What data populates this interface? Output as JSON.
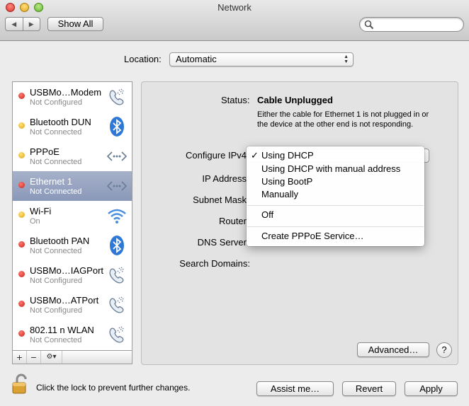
{
  "window": {
    "title": "Network"
  },
  "toolbar": {
    "back_label": "◀",
    "forward_label": "▶",
    "show_all_label": "Show All",
    "search_placeholder": ""
  },
  "location": {
    "label": "Location:",
    "value": "Automatic"
  },
  "services": [
    {
      "name": "USBMo…Modem",
      "status": "Not Configured",
      "dot": "red",
      "icon": "phone-icon"
    },
    {
      "name": "Bluetooth DUN",
      "status": "Not Connected",
      "dot": "yellow",
      "icon": "bluetooth-icon"
    },
    {
      "name": "PPPoE",
      "status": "Not Connected",
      "dot": "yellow",
      "icon": "network-arrows-icon"
    },
    {
      "name": "Ethernet 1",
      "status": "Not Connected",
      "dot": "red",
      "icon": "network-arrows-icon",
      "selected": true
    },
    {
      "name": "Wi-Fi",
      "status": "On",
      "dot": "yellow",
      "icon": "wifi-icon"
    },
    {
      "name": "Bluetooth PAN",
      "status": "Not Connected",
      "dot": "red",
      "icon": "bluetooth-icon"
    },
    {
      "name": "USBMo…IAGPort",
      "status": "Not Configured",
      "dot": "red",
      "icon": "phone-icon"
    },
    {
      "name": "USBMo…ATPort",
      "status": "Not Configured",
      "dot": "red",
      "icon": "phone-icon"
    },
    {
      "name": "802.11 n WLAN",
      "status": "Not Connected",
      "dot": "red",
      "icon": "phone-icon"
    }
  ],
  "sidebar_footer": {
    "add": "+",
    "remove": "−",
    "action": "⚙▾"
  },
  "detail": {
    "status_label": "Status:",
    "status_value": "Cable Unplugged",
    "status_description": "Either the cable for Ethernet 1 is not plugged in or the device at the other end is not responding.",
    "configure_label": "Configure IPv4",
    "ip_label": "IP Address",
    "subnet_label": "Subnet Mask",
    "router_label": "Router",
    "dns_label": "DNS Server",
    "search_domains_label": "Search Domains:"
  },
  "configure_menu": {
    "selected": "Using DHCP",
    "check": "✓",
    "items": [
      "Using DHCP",
      "Using DHCP with manual address",
      "Using BootP",
      "Manually",
      "Off",
      "Create PPPoE Service…"
    ]
  },
  "buttons": {
    "advanced": "Advanced…",
    "help": "?",
    "assist": "Assist me…",
    "revert": "Revert",
    "apply": "Apply"
  },
  "lock": {
    "text": "Click the lock to prevent further changes."
  },
  "colors": {
    "selection": "#8a98b9",
    "status_red": "#c7221a",
    "status_yellow": "#e0a41c"
  }
}
